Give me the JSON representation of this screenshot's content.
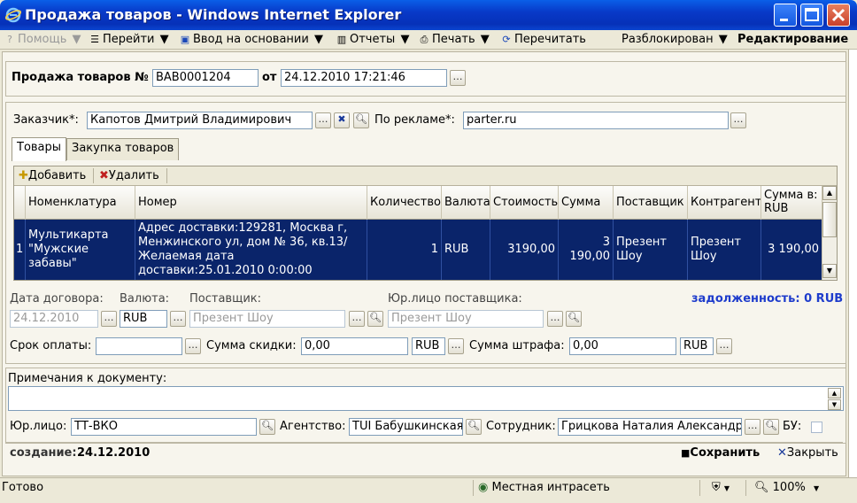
{
  "window": {
    "title": "Продажа товаров - Windows Internet Explorer"
  },
  "menu": {
    "help": "Помощь",
    "goto": "Перейти",
    "input_based": "Ввод на основании",
    "reports": "Отчеты",
    "print": "Печать",
    "reread": "Перечитать",
    "unlocked": "Разблокирован",
    "mode": "Редактирование"
  },
  "header": {
    "doc_label": "Продажа товаров №",
    "doc_number": "BAB0001204",
    "from_label": "от",
    "doc_date": "24.12.2010 17:21:46"
  },
  "customer": {
    "label": "Заказчик*:",
    "value": "Капотов Дмитрий Владимирович",
    "ad_label": "По рекламе*:",
    "ad_value": "parter.ru"
  },
  "tabs": [
    {
      "label": "Товары",
      "active": true
    },
    {
      "label": "Закупка товаров",
      "active": false
    }
  ],
  "grid_toolbar": {
    "add": "Добавить",
    "delete": "Удалить"
  },
  "grid": {
    "columns": [
      "Номенклатура",
      "Номер",
      "Количество",
      "Валюта",
      "Стоимость",
      "Сумма",
      "Поставщик",
      "Контрагент",
      "Сумма в: RUB"
    ],
    "rows": [
      {
        "index": "1",
        "nomenclature": "Мультикарта \"Мужские забавы\"",
        "number": "Адрес доставки:129281, Москва г, Менжинского ул, дом № 36, кв.13/Желаемая дата доставки:25.01.2010 0:00:00",
        "quantity": "1",
        "currency": "RUB",
        "cost": "3190,00",
        "sum": "3 190,00",
        "supplier": "Презент Шоу",
        "counterparty": "Презент Шоу",
        "sum_rub": "3 190,00"
      }
    ]
  },
  "details": {
    "contract_date_label": "Дата договора:",
    "contract_date": "24.12.2010",
    "currency_label": "Валюта:",
    "currency": "RUB",
    "supplier_label": "Поставщик:",
    "supplier": "Презент Шоу",
    "legal_supplier_label": "Юр.лицо поставщика:",
    "legal_supplier": "Презент Шоу",
    "debt": "задолженность: 0 RUB",
    "pay_term_label": "Срок оплаты:",
    "pay_term": "",
    "discount_label": "Сумма скидки:",
    "discount": "0,00",
    "discount_currency": "RUB",
    "penalty_label": "Сумма штрафа:",
    "penalty": "0,00",
    "penalty_currency": "RUB"
  },
  "notes": {
    "label": "Примечания к документу:",
    "value": ""
  },
  "bottom_fields": {
    "legal_label": "Юр.лицо:",
    "legal": "ТТ-ВКО",
    "agency_label": "Агентство:",
    "agency": "TUI Бабушкинская",
    "employee_label": "Сотрудник:",
    "employee": "Грицкова Наталия Александр",
    "bu_label": "БУ:"
  },
  "footer": {
    "created_label": "создание:",
    "created_date": "24.12.2010",
    "save": "Сохранить",
    "close": "Закрыть"
  },
  "status": {
    "ready": "Готово",
    "zone": "Местная интрасеть",
    "zoom": "100%"
  }
}
